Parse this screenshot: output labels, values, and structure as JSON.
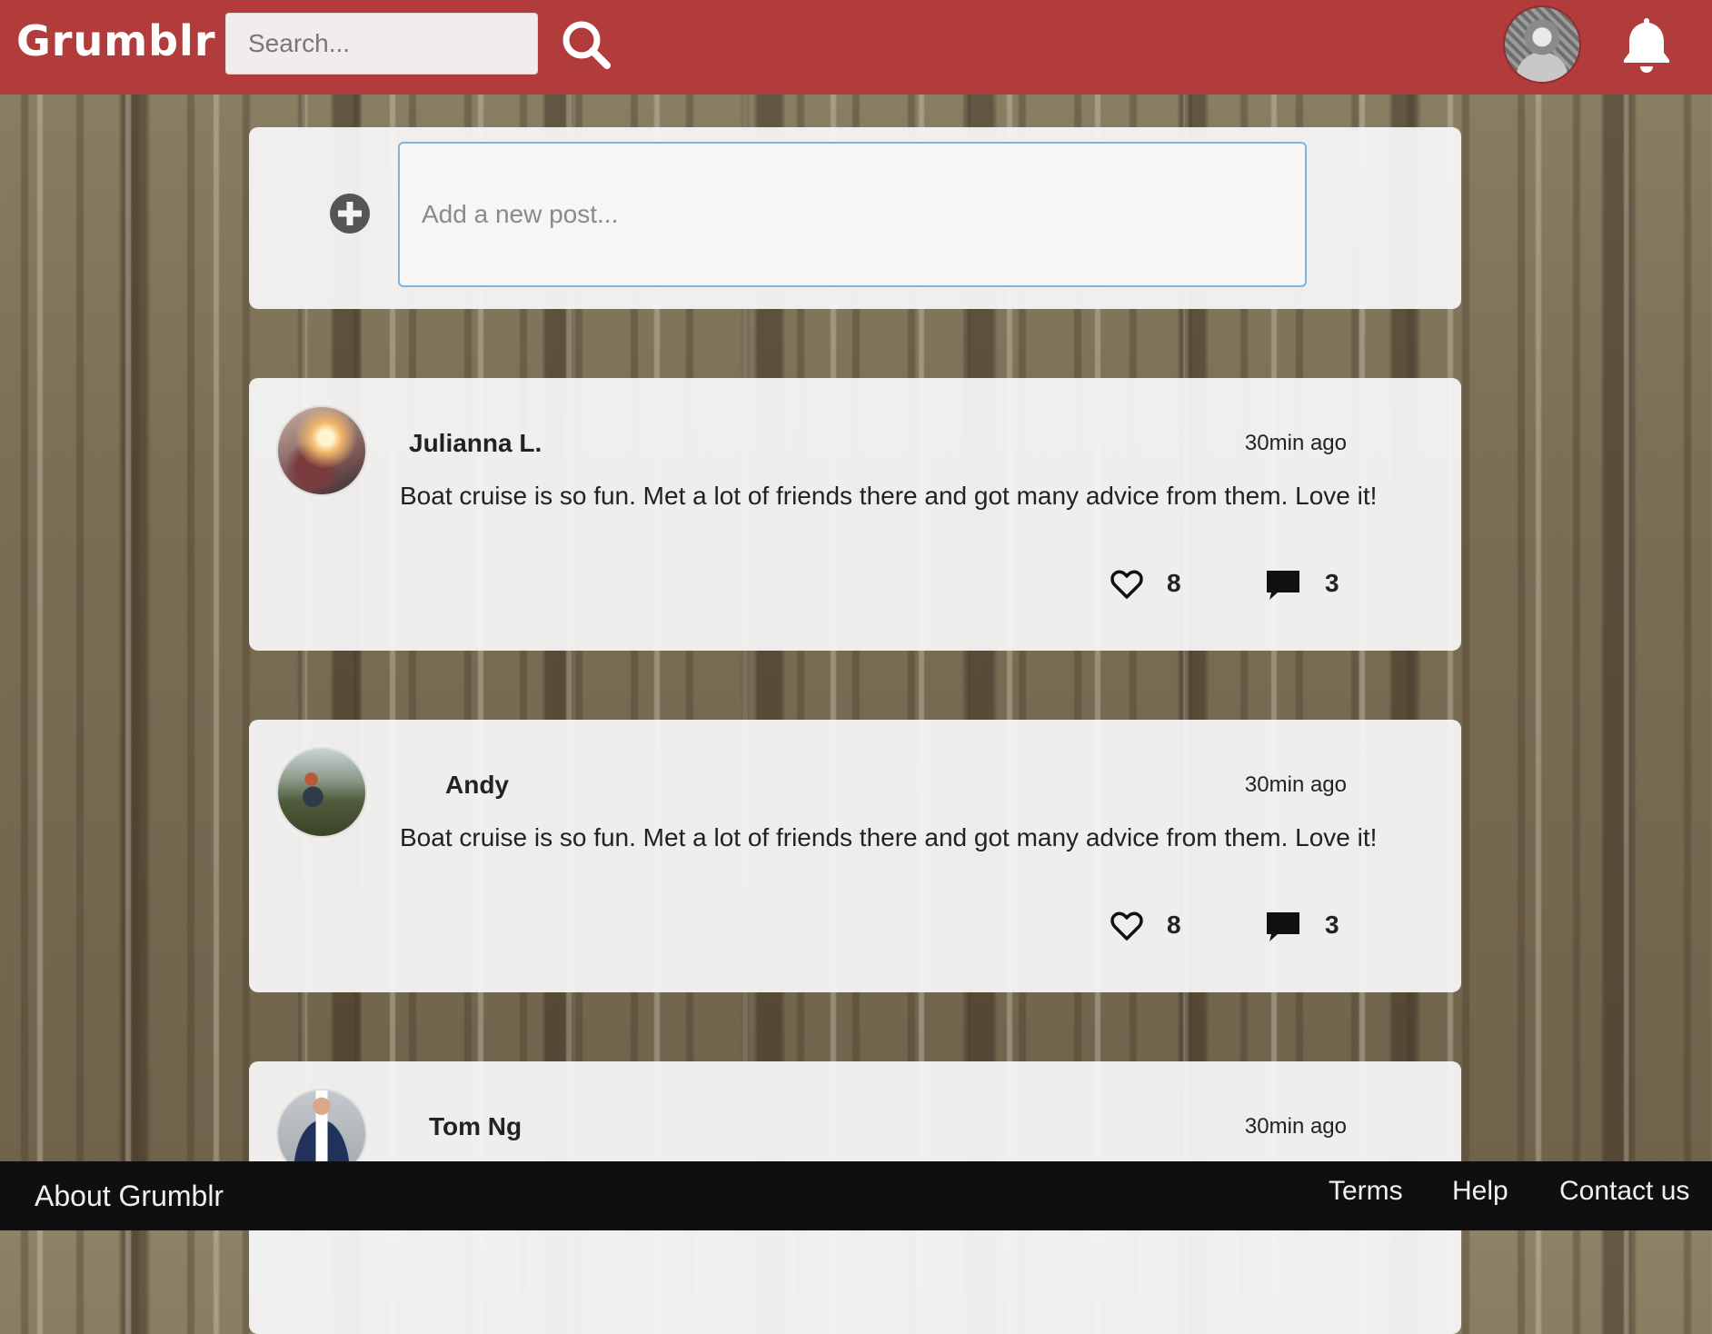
{
  "app": {
    "logo": "Grumblr"
  },
  "header": {
    "search_placeholder": "Search..."
  },
  "composer": {
    "placeholder": "Add a new post..."
  },
  "posts": [
    {
      "author": "Julianna L.",
      "time": "30min ago",
      "body": "Boat cruise is so fun. Met a lot of friends there and got many advice from them. Love it!",
      "likes": "8",
      "comments": "3"
    },
    {
      "author": "Andy",
      "time": "30min ago",
      "body": "Boat cruise is so fun. Met a lot of friends there and got many advice from them. Love it!",
      "likes": "8",
      "comments": "3"
    },
    {
      "author": "Tom Ng",
      "time": "30min ago"
    }
  ],
  "footer": {
    "about": "About Grumblr",
    "links": [
      "Terms",
      "Help",
      "Contact us"
    ]
  },
  "colors": {
    "header_bg": "#b13c3b",
    "footer_bg": "#0f0f0f",
    "input_focus_border": "#7fb2dc"
  },
  "icons": {
    "search": "search-icon",
    "notifications": "bell-icon",
    "add_post": "plus-circle-icon",
    "like": "heart-outline-icon",
    "comment": "speech-bubble-icon"
  }
}
